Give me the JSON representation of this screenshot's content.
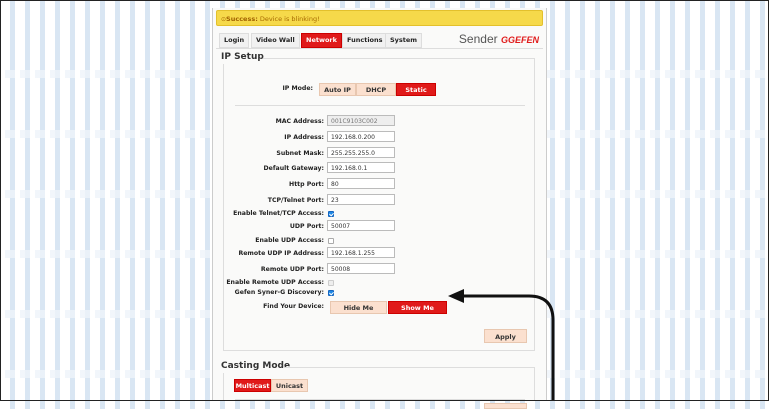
{
  "banner": {
    "prefix": "Success:",
    "text": "Device is blinking!"
  },
  "nav": {
    "tabs": [
      "Login",
      "Video Wall",
      "Network",
      "Functions",
      "System"
    ],
    "active": "Network",
    "mode_label": "Sender",
    "brand": "GEFEN"
  },
  "ip_setup": {
    "title": "IP Setup",
    "mode_label": "IP Mode:",
    "modes": [
      "Auto IP",
      "DHCP",
      "Static"
    ],
    "active_mode": "Static",
    "fields": {
      "mac_label": "MAC Address:",
      "mac": "001C9103C002",
      "ip_label": "IP Address:",
      "ip": "192.168.0.200",
      "subnet_label": "Subnet Mask:",
      "subnet": "255.255.255.0",
      "gateway_label": "Default Gateway:",
      "gateway": "192.168.0.1",
      "http_label": "Http Port:",
      "http": "80",
      "telnet_label": "TCP/Telnet Port:",
      "telnet": "23",
      "enable_telnet_label": "Enable Telnet/TCP Access:",
      "udp_label": "UDP Port:",
      "udp": "50007",
      "enable_udp_label": "Enable UDP Access:",
      "remote_ip_label": "Remote UDP IP Address:",
      "remote_ip": "192.168.1.255",
      "remote_port_label": "Remote UDP Port:",
      "remote_port": "50008",
      "enable_remote_label": "Enable Remote UDP Access:",
      "syner_label": "Gefen Syner-G Discovery:"
    },
    "checkboxes": {
      "telnet": true,
      "udp": false,
      "remote_udp": false,
      "syner_g": true
    },
    "find_label": "Find Your Device:",
    "hide_label": "Hide Me",
    "show_label": "Show Me",
    "apply_label": "Apply"
  },
  "casting": {
    "title": "Casting Mode",
    "modes": [
      "Multicast",
      "Unicast"
    ],
    "active_mode": "Multicast"
  },
  "colors": {
    "accent": "#e01a1a",
    "banner": "#f6d94a",
    "button": "#fbe0cf"
  }
}
